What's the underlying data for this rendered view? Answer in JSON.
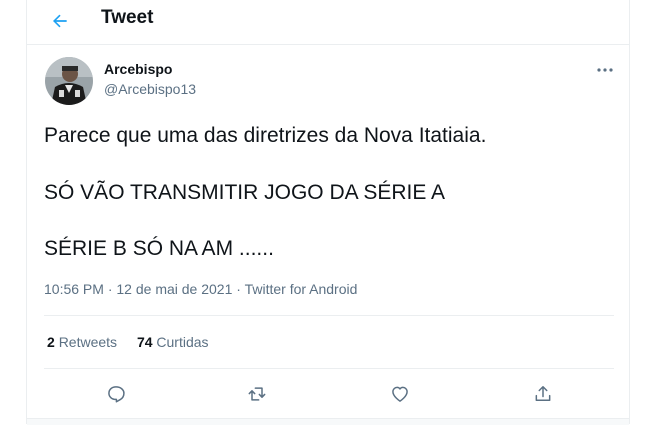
{
  "header": {
    "title": "Tweet",
    "back_icon": "arrow-left-icon"
  },
  "author": {
    "name": "Arcebispo",
    "handle": "@Arcebispo13",
    "avatar": "avatar-image"
  },
  "more_icon": "more-horizontal-icon",
  "tweet": {
    "lines": [
      "Parece que uma das diretrizes da Nova Itatiaia.",
      "SÓ VÃO TRANSMITIR JOGO DA SÉRIE A",
      "SÉRIE B SÓ NA AM ......"
    ]
  },
  "meta": {
    "time": "10:56 PM",
    "separator": "·",
    "date": "12 de mai de 2021",
    "source": "Twitter for Android"
  },
  "stats": {
    "retweets_count": "2",
    "retweets_label": "Retweets",
    "likes_count": "74",
    "likes_label": "Curtidas"
  },
  "actions": [
    {
      "name": "reply",
      "icon": "reply-icon"
    },
    {
      "name": "retweet",
      "icon": "retweet-icon"
    },
    {
      "name": "like",
      "icon": "heart-icon"
    },
    {
      "name": "share",
      "icon": "share-icon"
    }
  ],
  "colors": {
    "accent": "#1da1f2",
    "text": "#0f1419",
    "secondary": "#5b7083",
    "border": "#ebeef0"
  }
}
